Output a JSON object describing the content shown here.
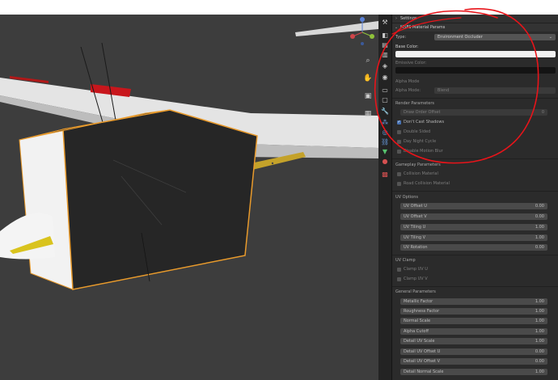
{
  "properties": {
    "settings_header": "Settings",
    "panel_title": "MSFS Material Params",
    "type_label": "Type:",
    "type_value": "Environment Occluder",
    "base_color_label": "Base Color:",
    "emissive_color_label": "Emissive Color:",
    "alpha_mode_header": "Alpha Mode",
    "alpha_mode_label": "Alpha Mode:",
    "alpha_mode_value": "Blend",
    "render_params": {
      "header": "Render Parameters",
      "draw_order_offset_label": "Draw Order Offset",
      "draw_order_offset_value": "0",
      "checkboxes": [
        {
          "label": "Don't Cast Shadows",
          "checked": true
        },
        {
          "label": "Double Sided",
          "checked": false
        },
        {
          "label": "Day Night Cycle",
          "checked": false
        },
        {
          "label": "Disable Motion Blur",
          "checked": false
        }
      ]
    },
    "gameplay": {
      "header": "Gameplay Parameters",
      "checkboxes": [
        {
          "label": "Collision Material",
          "checked": false
        },
        {
          "label": "Road Collision Material",
          "checked": false
        }
      ]
    },
    "uv_options": {
      "header": "UV Options",
      "fields": [
        {
          "label": "UV Offset U",
          "value": "0.00"
        },
        {
          "label": "UV Offset V",
          "value": "0.00"
        },
        {
          "label": "UV Tiling U",
          "value": "1.00"
        },
        {
          "label": "UV Tiling V",
          "value": "1.00"
        },
        {
          "label": "UV Rotation",
          "value": "0.00"
        }
      ]
    },
    "uv_clamp": {
      "header": "UV Clamp",
      "checkboxes": [
        {
          "label": "Clamp UV U",
          "checked": false
        },
        {
          "label": "Clamp UV V",
          "checked": false
        }
      ]
    },
    "general": {
      "header": "General Parameters",
      "fields": [
        {
          "label": "Metallic Factor",
          "value": "1.00"
        },
        {
          "label": "Roughness Factor",
          "value": "1.00"
        },
        {
          "label": "Normal Scale",
          "value": "1.00"
        },
        {
          "label": "Alpha Cutoff",
          "value": "1.00"
        },
        {
          "label": "Detail UV Scale",
          "value": "1.00"
        },
        {
          "label": "Detail UV Offset U",
          "value": "0.00"
        },
        {
          "label": "Detail UV Offset V",
          "value": "0.00"
        },
        {
          "label": "Detail Normal Scale",
          "value": "1.00"
        }
      ]
    }
  },
  "toolstrip_icons": [
    "tool-icon",
    "render-icon",
    "output-icon",
    "view-layer-icon",
    "scene-icon",
    "world-icon",
    "collection-icon",
    "object-icon",
    "modifier-icon",
    "particles-icon",
    "physics-icon",
    "constraints-icon",
    "data-icon",
    "material-icon",
    "texture-icon"
  ],
  "gizmo_axes": [
    "z-axis-icon",
    "y-axis-icon",
    "x-axis-icon"
  ],
  "colors": {
    "selection_outline": "#e89a2c",
    "checkbox_on": "#4772b3",
    "annotation": "#e8141a"
  }
}
